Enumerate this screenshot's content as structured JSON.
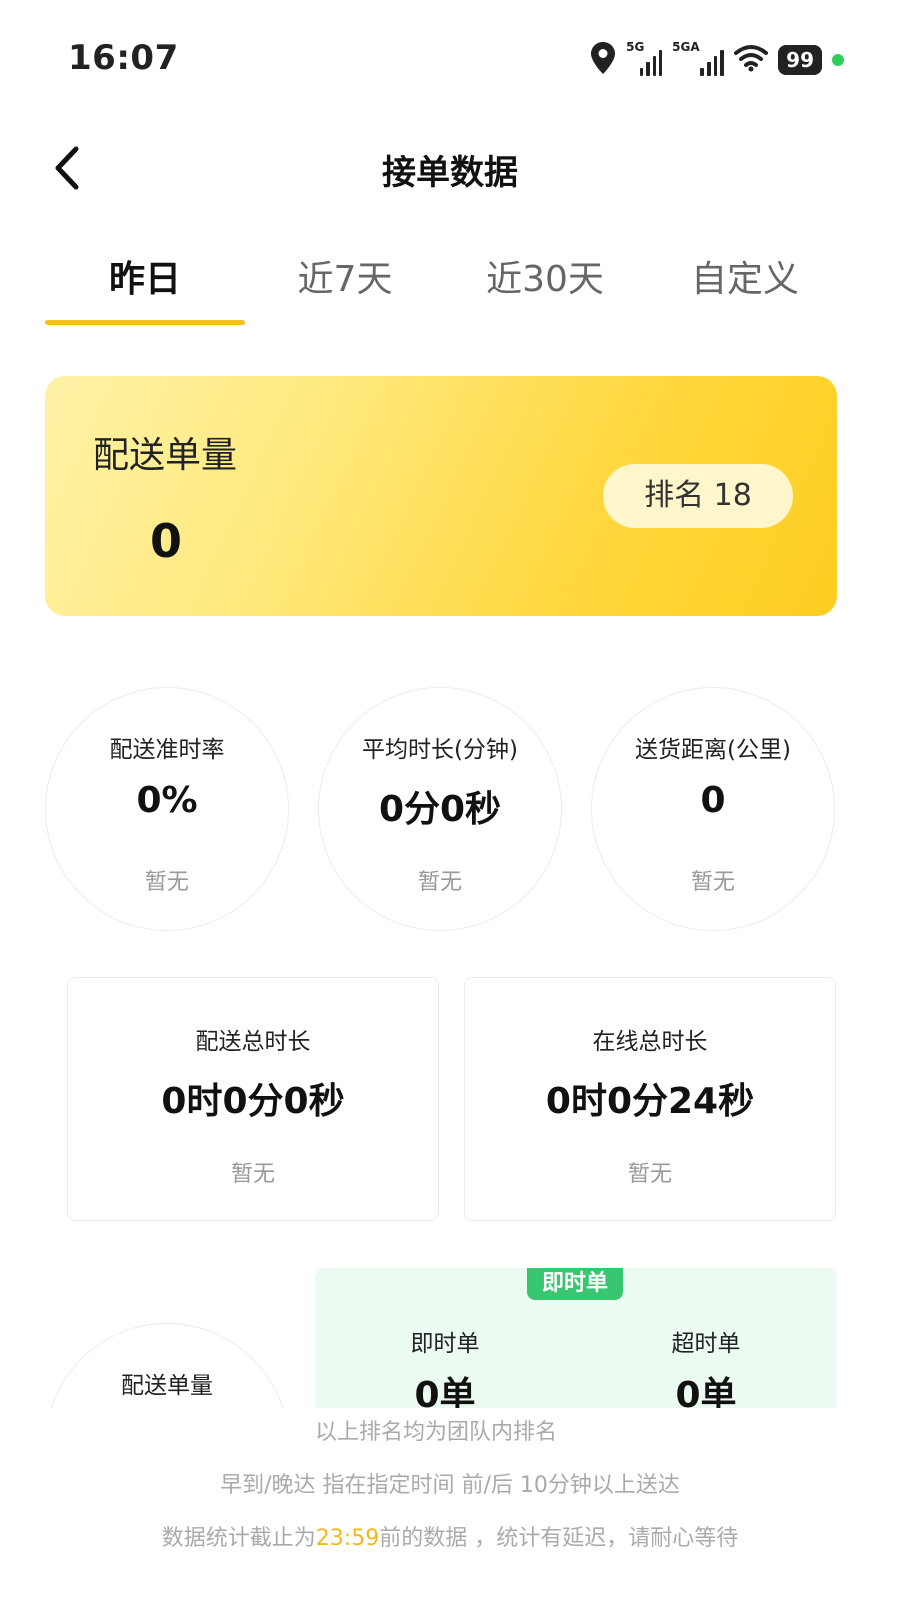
{
  "status_bar": {
    "time": "16:07",
    "network_1": "5G",
    "network_2": "5GA",
    "battery": "99"
  },
  "header": {
    "title": "接单数据"
  },
  "tabs": [
    {
      "label": "昨日",
      "active": true
    },
    {
      "label": "近7天",
      "active": false
    },
    {
      "label": "近30天",
      "active": false
    },
    {
      "label": "自定义",
      "active": false
    }
  ],
  "summary": {
    "label": "配送单量",
    "value": "0",
    "rank_text": "排名 18"
  },
  "circle_stats": [
    {
      "label": "配送准时率",
      "value": "0%",
      "sub": "暂无"
    },
    {
      "label": "平均时长(分钟)",
      "value": "0分0秒",
      "sub": "暂无"
    },
    {
      "label": "送货距离(公里)",
      "value": "0",
      "sub": "暂无"
    }
  ],
  "box_stats": [
    {
      "label": "配送总时长",
      "value": "0时0分0秒",
      "sub": "暂无"
    },
    {
      "label": "在线总时长",
      "value": "0时0分24秒",
      "sub": "暂无"
    }
  ],
  "order_section": {
    "circle_label": "配送单量",
    "tag": "即时单",
    "columns": [
      {
        "label": "即时单",
        "value": "0单"
      },
      {
        "label": "超时单",
        "value": "0单"
      }
    ]
  },
  "footnotes": {
    "line1": "以上排名均为团队内排名",
    "line2": "早到/晚达  指在指定时间 前/后 10分钟以上送达",
    "line3_prefix": "数据统计截止为",
    "line3_time": "23:59",
    "line3_suffix": "前的数据 ，统计有延迟，请耐心等待"
  },
  "colors": {
    "accent_yellow": "#f6bf1c",
    "green_tag": "#39c671",
    "green_bg": "#ebfbf2"
  }
}
